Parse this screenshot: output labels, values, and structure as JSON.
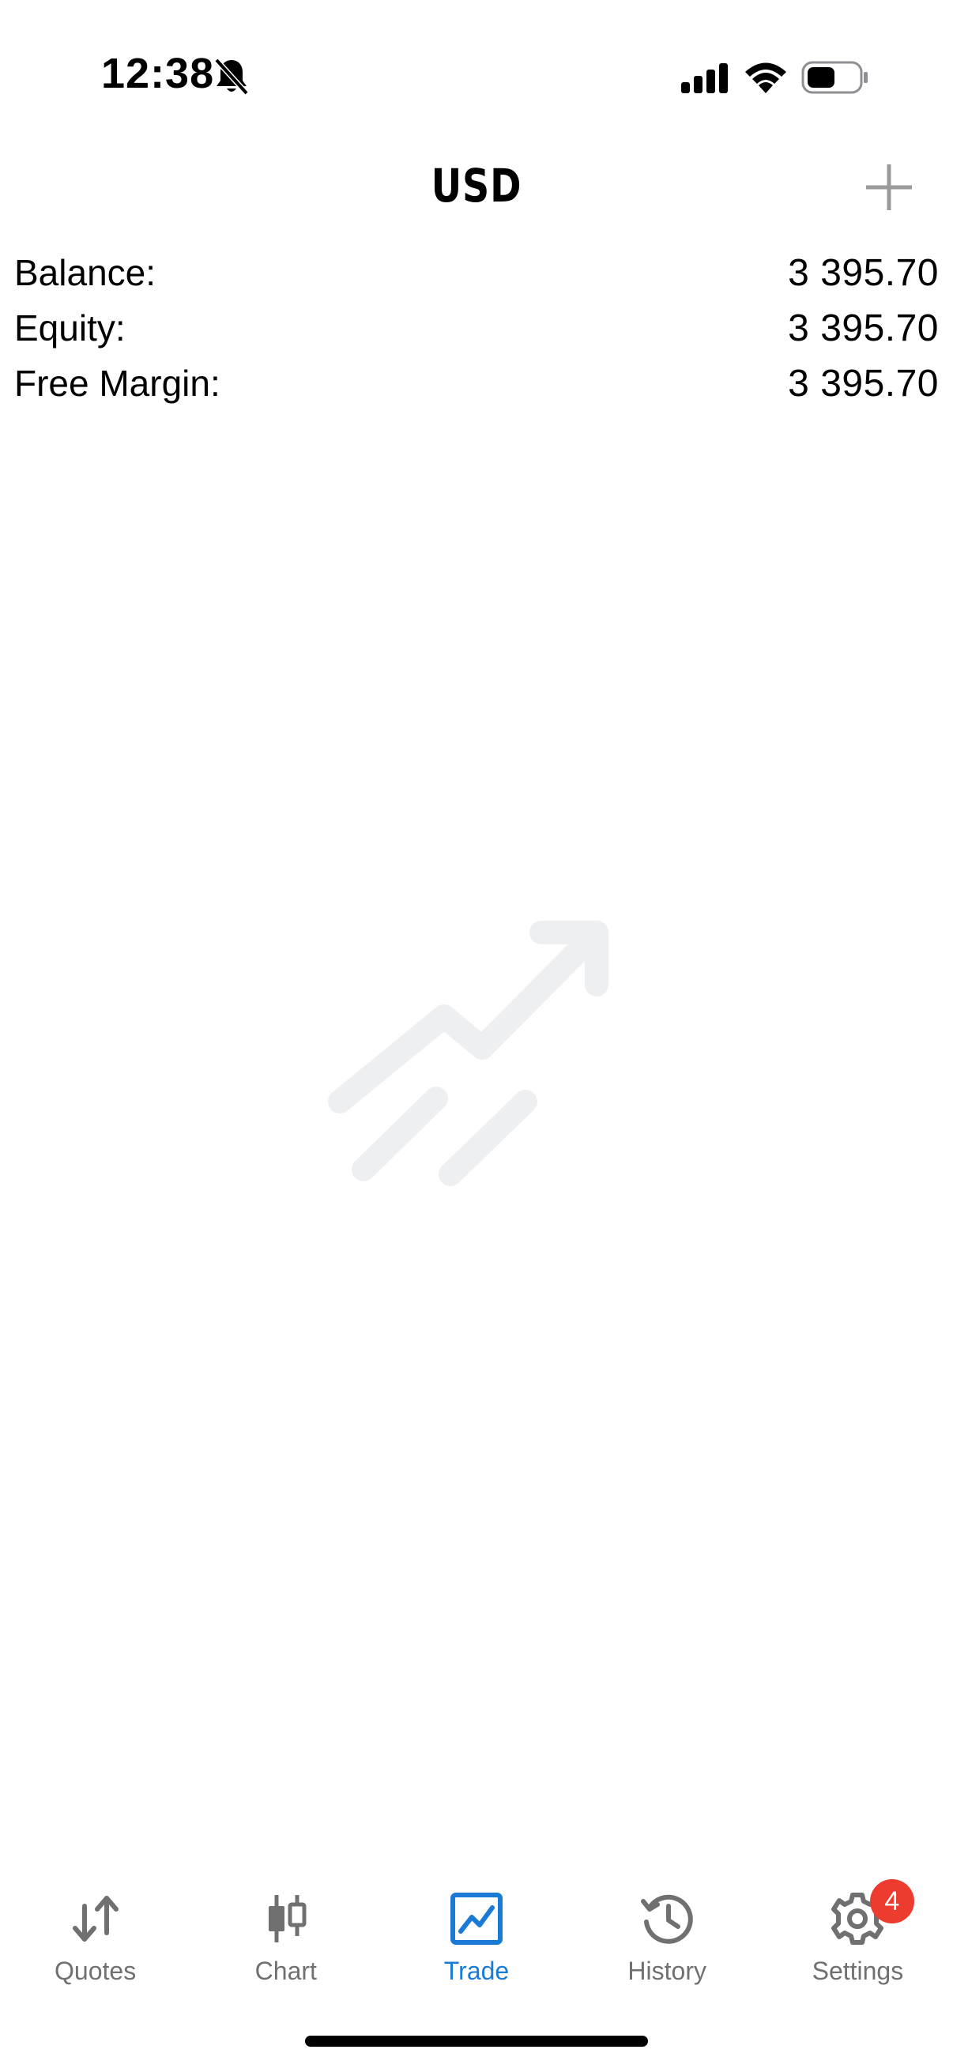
{
  "status_bar": {
    "time": "12:38",
    "icons": [
      "bell-off-icon",
      "signal-icon",
      "wifi-icon",
      "battery-icon"
    ]
  },
  "nav": {
    "title": "USD",
    "add_icon": "plus-icon"
  },
  "summary": [
    {
      "label": "Balance:",
      "value": "3 395.70"
    },
    {
      "label": "Equity:",
      "value": "3 395.70"
    },
    {
      "label": "Free Margin:",
      "value": "3 395.70"
    }
  ],
  "empty_state": {
    "icon": "trend-up-arrow-icon"
  },
  "tabs": [
    {
      "label": "Quotes",
      "icon": "arrows-up-down-icon"
    },
    {
      "label": "Chart",
      "icon": "candlestick-icon"
    },
    {
      "label": "Trade",
      "icon": "trade-chart-icon",
      "active": true
    },
    {
      "label": "History",
      "icon": "history-icon"
    },
    {
      "label": "Settings",
      "icon": "gear-icon",
      "badge": "4"
    }
  ],
  "colors": {
    "accent": "#1a7bd6",
    "tab_inactive": "#707070",
    "badge": "#ee3b30",
    "empty_icon": "#eeeff1"
  }
}
